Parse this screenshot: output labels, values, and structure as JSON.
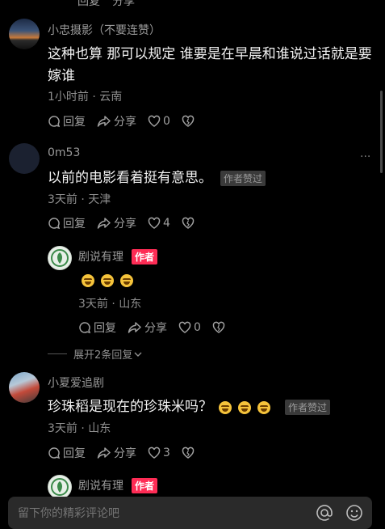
{
  "top_partial": {
    "reply": "回复",
    "share": "分享"
  },
  "comments": [
    {
      "user": "小忠摄影（不要连赞）",
      "text": "这种也算 那可以规定 谁要是在早晨和谁说过话就是要嫁谁",
      "meta": "1小时前 · 云南",
      "reply": "回复",
      "share": "分享",
      "likes": "0"
    },
    {
      "user": "0m53",
      "text": "以前的电影看着挺有意思。",
      "badge": "作者赞过",
      "meta": "3天前 · 天津",
      "reply": "回复",
      "share": "分享",
      "likes": "4",
      "more": "···"
    },
    {
      "user": "小夏爱追剧",
      "text": "珍珠稻是现在的珍珠米吗？",
      "badge": "作者赞过",
      "meta": "3天前 · 山东",
      "reply": "回复",
      "share": "分享",
      "likes": "3"
    }
  ],
  "reply1": {
    "user": "剧说有理",
    "author_tag": "作者",
    "meta": "3天前 · 山东",
    "reply": "回复",
    "share": "分享",
    "likes": "0"
  },
  "expand": "展开2条回复",
  "reply2": {
    "user": "剧说有理",
    "author_tag": "作者"
  },
  "input": {
    "placeholder": "留下你的精彩评论吧"
  },
  "colors": {
    "bg": "#000000",
    "accent": "#fe2c55"
  }
}
